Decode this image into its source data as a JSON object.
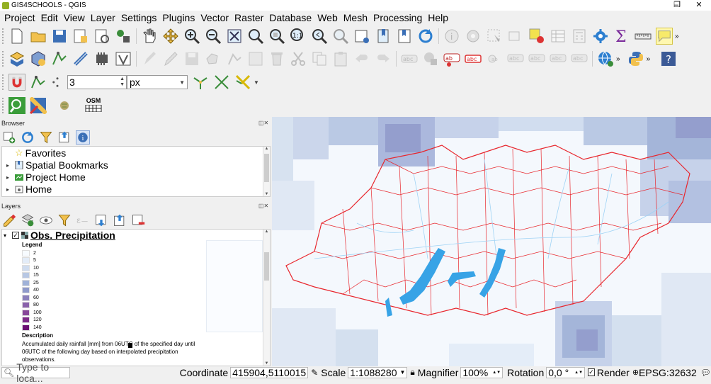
{
  "window": {
    "title": "GIS4SCHOOLS - QGIS",
    "minimize": "–",
    "maximize": "❐",
    "close": "✕"
  },
  "menu": [
    "Project",
    "Edit",
    "View",
    "Layer",
    "Settings",
    "Plugins",
    "Vector",
    "Raster",
    "Database",
    "Web",
    "Mesh",
    "Processing",
    "Help"
  ],
  "snapping": {
    "tolerance": "3",
    "units": "px"
  },
  "osm_label": "OSM",
  "browser": {
    "title": "Browser",
    "items": [
      {
        "label": "Favorites",
        "icon": "star-icon"
      },
      {
        "label": "Spatial Bookmarks",
        "icon": "bookmark-icon"
      },
      {
        "label": "Project Home",
        "icon": "project-home-icon"
      },
      {
        "label": "Home",
        "icon": "home-folder-icon"
      }
    ]
  },
  "layers": {
    "title": "Layers",
    "layer_name": "Obs. Precipitation",
    "legend_title": "Legend",
    "legend": [
      {
        "label": "2",
        "color": "#f7fbff"
      },
      {
        "label": "5",
        "color": "#e3ecf8"
      },
      {
        "label": "10",
        "color": "#cfdcef"
      },
      {
        "label": "15",
        "color": "#b7c7e3"
      },
      {
        "label": "25",
        "color": "#a0b2d8"
      },
      {
        "label": "40",
        "color": "#8f9acb"
      },
      {
        "label": "60",
        "color": "#8b80bc"
      },
      {
        "label": "80",
        "color": "#8a62ab"
      },
      {
        "label": "100",
        "color": "#874799"
      },
      {
        "label": "120",
        "color": "#7d2a88"
      },
      {
        "label": "140",
        "color": "#6a0f72"
      }
    ],
    "description_title": "Description",
    "description_lines": [
      "Accumulated daily rainfall [mm] from 06UTC of the specified day until",
      "06UTC of the following day based on interpolated precipitation",
      "observations."
    ]
  },
  "statusbar": {
    "search_placeholder": "Type to loca...",
    "coordinate_label": "Coordinate",
    "coordinate": "415904,5110015",
    "scale_label": "Scale",
    "scale": "1:1088280",
    "magnifier_label": "Magnifier",
    "magnifier": "100%",
    "rotation_label": "Rotation",
    "rotation": "0,0 °",
    "render_label": "Render",
    "crs": "EPSG:32632"
  },
  "colors": {
    "accent": "#93b023",
    "map_boundaries": "#e8262d",
    "map_rivers": "#9fd3f5",
    "map_lakes": "#37a3e6"
  }
}
